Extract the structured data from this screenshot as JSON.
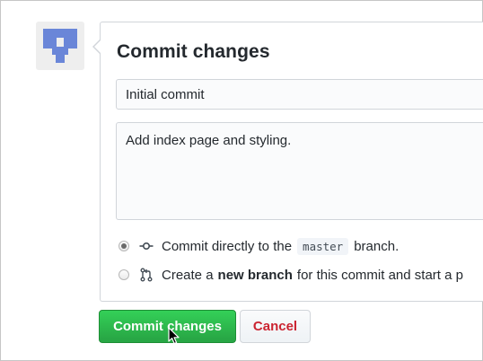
{
  "form": {
    "title": "Commit changes",
    "summary_value": "Initial commit",
    "description_value": "Add index page and styling."
  },
  "options": {
    "direct": {
      "selected": true,
      "icon": "git-commit-icon",
      "text_before": "Commit directly to the",
      "branch": "master",
      "text_after": "branch."
    },
    "new_branch": {
      "selected": false,
      "icon": "git-pull-request-icon",
      "text_before": "Create a",
      "bold": "new branch",
      "text_after": "for this commit and start a p"
    }
  },
  "buttons": {
    "commit_label": "Commit changes",
    "cancel_label": "Cancel"
  },
  "colors": {
    "commit_button": "#28a745",
    "cancel_text": "#cb2431",
    "avatar_blue": "#6a86d8"
  }
}
